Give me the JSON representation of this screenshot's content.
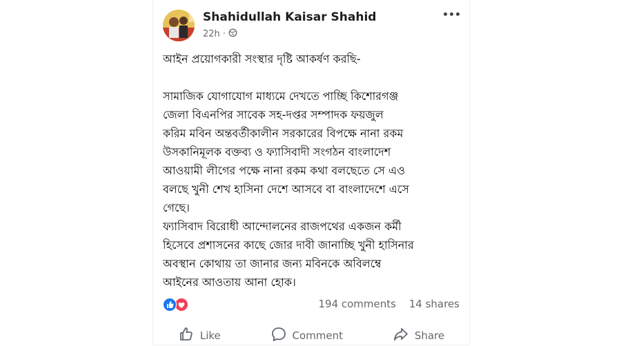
{
  "post": {
    "author": "Shahidullah Kaisar Shahid",
    "time": "22h",
    "privacy_icon": "globe-icon",
    "more_icon": "more-dots-icon",
    "lines_intro": "আইন প্রয়োগকারী সংস্থার দৃষ্টি আকর্ষণ করছি-",
    "paragraph1": [
      "সামাজিক যোগাযোগ মাধ্যমে দেখতে পাচ্ছি  কিশোরগঞ্জ",
      "জেলা বিএনপির সাবেক সহ-দপ্তর সম্পাদক ফয়জুল",
      "করিম মবিন অন্তবর্তীকালীন সরকারের বিপক্ষে নানা রকম",
      "উসকানিমূলক বক্তব্য ও  ফ্যাসিবাদী সংগঠন বাংলাদেশ",
      "আওয়ামী লীগের পক্ষে নানা রকম কথা বলছেতে সে এও",
      "বলছে খুনী শেখ হাসিনা দেশে আসবে বা বাংলাদেশে এসে",
      "গেছে।"
    ],
    "paragraph2": [
      "ফ্যাসিবাদ বিরোধী আন্দোলনের রাজপথের একজন কর্মী",
      "হিসেবে প্রশাসনের কাছে জোর দাবী জানাচ্ছি খুনী হাসিনার",
      "অবস্থান কোথায় তা জানার জন্য মবিনকে অবিলম্বে",
      "আইনের আওতায় আনা হোক।"
    ]
  },
  "stats": {
    "reaction_icons": [
      "like-reaction-icon",
      "love-reaction-icon"
    ],
    "comments": "194 comments",
    "shares": "14 shares"
  },
  "actions": {
    "like_label": "Like",
    "comment_label": "Comment",
    "share_label": "Share"
  },
  "colors": {
    "text": "#050505",
    "secondary": "#65676b",
    "like_blue": "#1877f2",
    "love_red": "#f33e58"
  }
}
